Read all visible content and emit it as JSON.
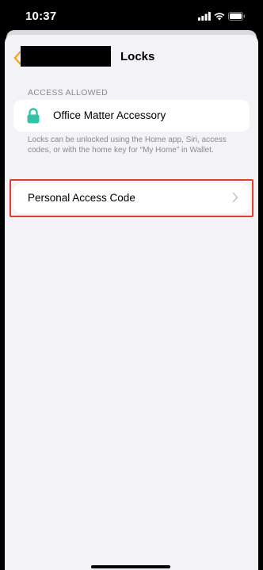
{
  "status_bar": {
    "time": "10:37",
    "icons": [
      "cellular-signal-icon",
      "wifi-icon",
      "battery-icon"
    ]
  },
  "nav": {
    "back_icon": "chevron-left-icon",
    "title": "Locks",
    "accent_color": "#f5a623"
  },
  "access": {
    "section_header": "ACCESS ALLOWED",
    "accessory_name": "Office Matter Accessory",
    "lock_icon": "lock-icon",
    "lock_color": "#32c2a8",
    "footnote": "Locks can be unlocked using the Home app, Siri, access codes, or with the home key for “My Home” in Wallet."
  },
  "personal_code_row": {
    "label": "Personal Access Code",
    "chevron_icon": "chevron-right-icon",
    "highlight_color": "#e23a2c"
  }
}
